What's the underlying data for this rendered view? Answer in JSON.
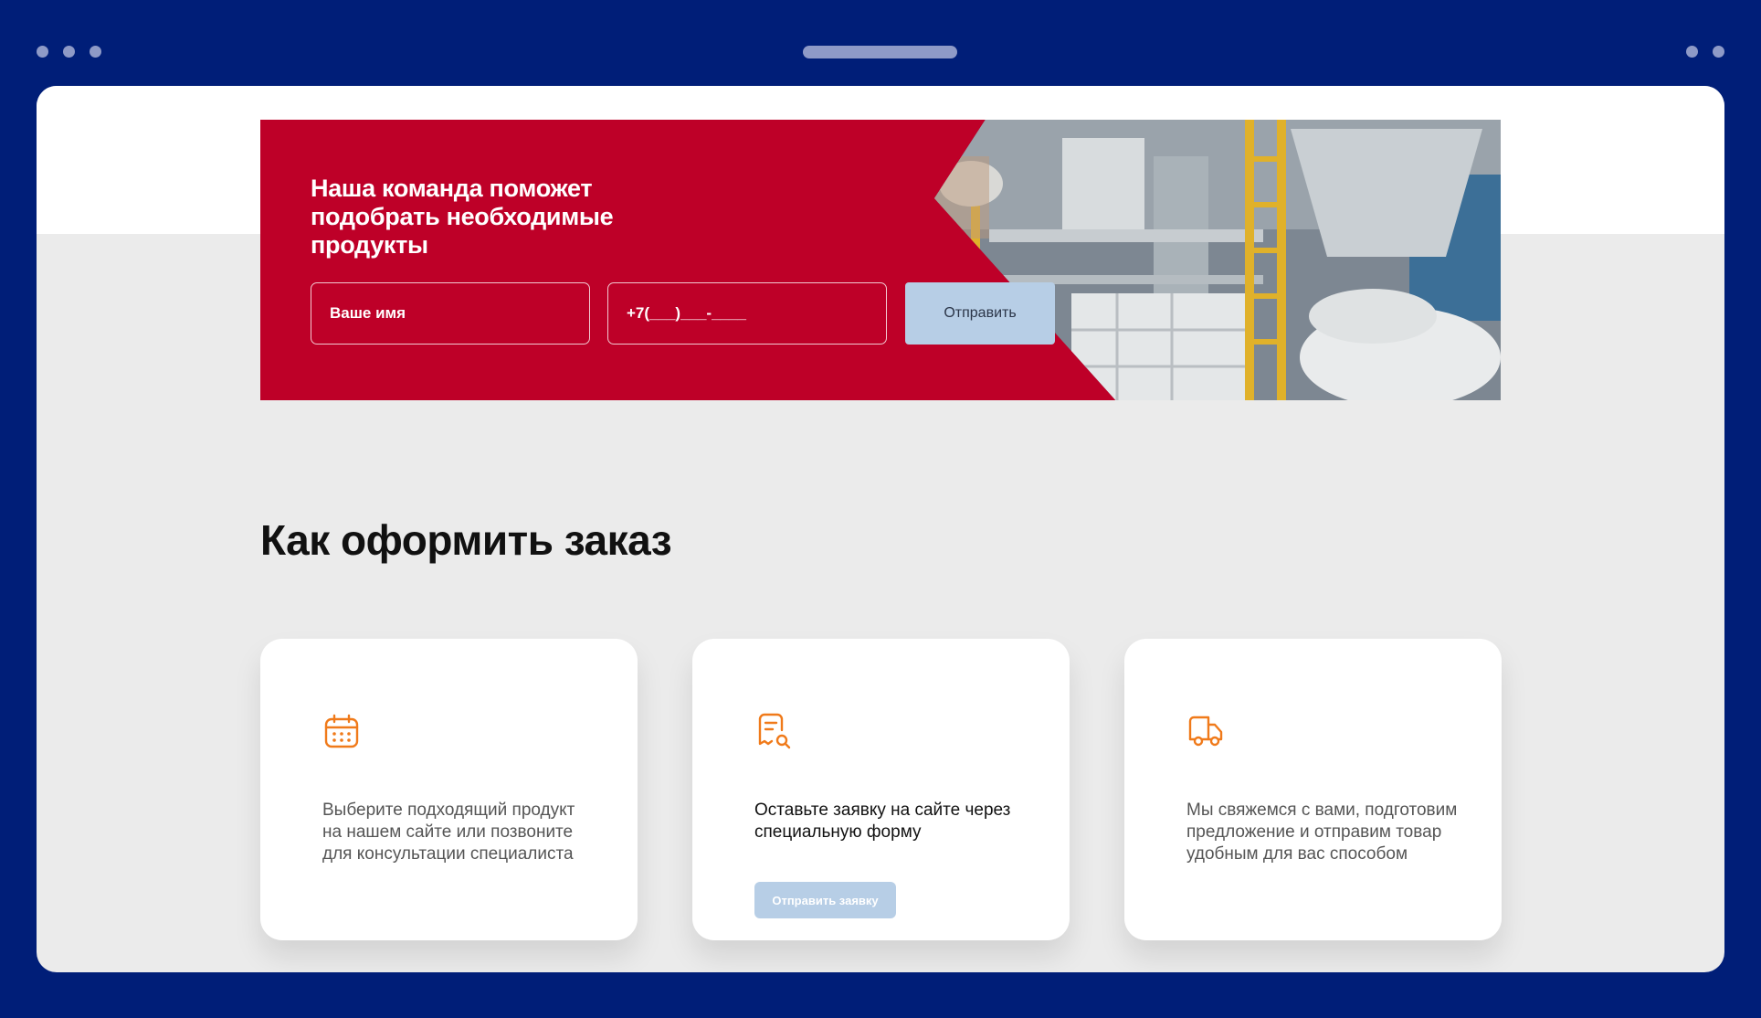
{
  "banner": {
    "title": "Наша команда поможет подобрать необходимые продукты",
    "name_placeholder": "Ваше имя",
    "phone_placeholder": "+7(___)___-____",
    "submit_label": "Отправить",
    "accent_color": "#BE0028"
  },
  "order_section": {
    "title": "Как оформить заказ",
    "steps": [
      {
        "icon": "calendar-icon",
        "text": "Выберите подходящий продукт на нашем сайте или позвоните для консультации специалиста"
      },
      {
        "icon": "document-search-icon",
        "text": "Оставьте заявку на сайте через специальную форму",
        "button_label": "Отправить заявку"
      },
      {
        "icon": "truck-icon",
        "text": "Мы свяжемся с вами, подготовим предложение и отправим товар удобным для вас способом"
      }
    ],
    "icon_color": "#F07A1A"
  }
}
